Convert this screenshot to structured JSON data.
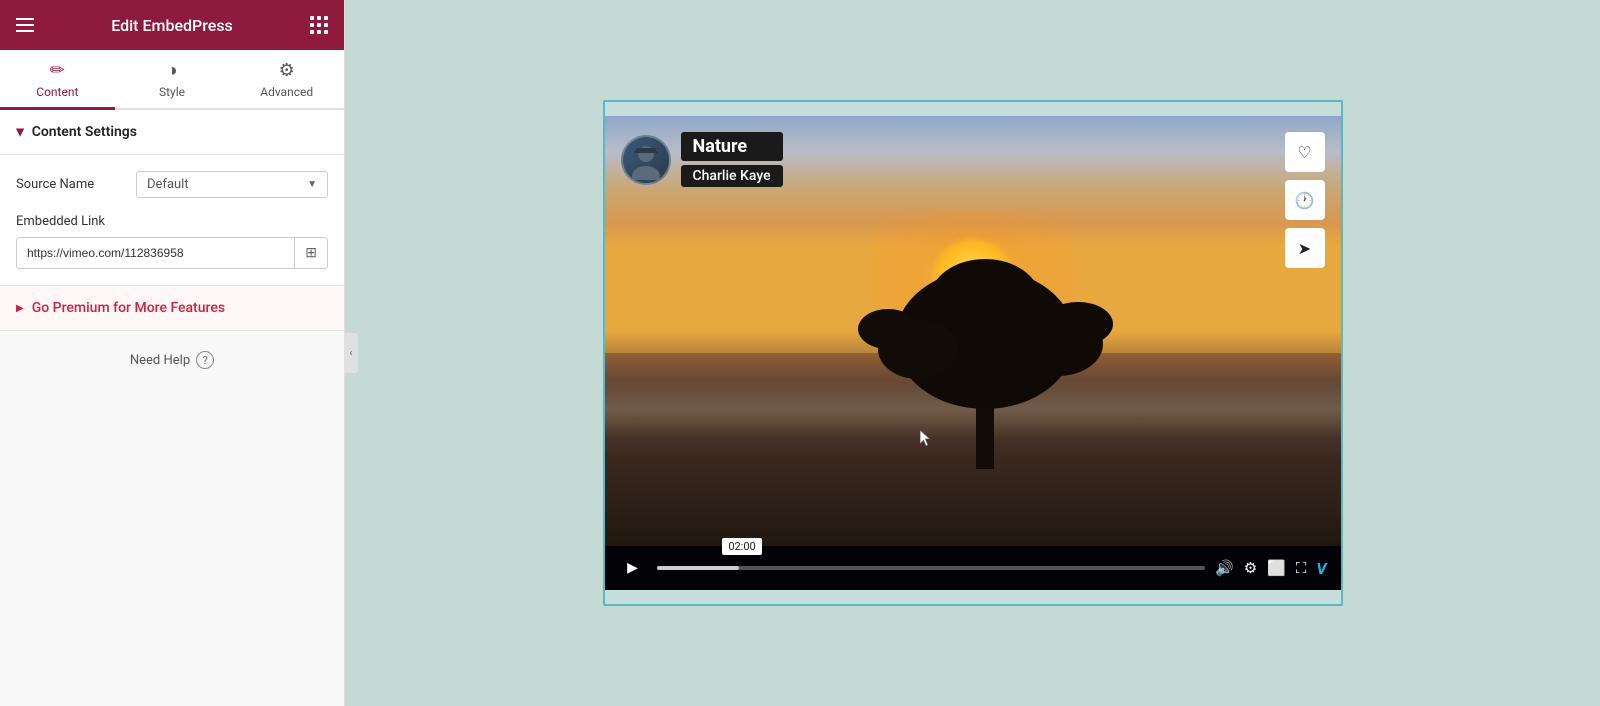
{
  "header": {
    "title": "Edit EmbedPress",
    "hamburger_label": "menu",
    "grid_label": "apps"
  },
  "tabs": [
    {
      "id": "content",
      "label": "Content",
      "icon": "✏️",
      "active": true
    },
    {
      "id": "style",
      "label": "Style",
      "icon": "◑"
    },
    {
      "id": "advanced",
      "label": "Advanced",
      "icon": "⚙️"
    }
  ],
  "content_settings": {
    "section_title": "Content Settings",
    "source_name_label": "Source Name",
    "source_name_value": "Default",
    "embedded_link_label": "Embedded Link",
    "embedded_link_value": "https://vimeo.com/112836958",
    "embedded_link_placeholder": "https://vimeo.com/112836958"
  },
  "premium": {
    "label": "Go Premium for More Features"
  },
  "help": {
    "label": "Need Help"
  },
  "video": {
    "title": "Nature",
    "author": "Charlie Kaye",
    "time_tooltip": "02:00",
    "vimeo_mark": "V"
  }
}
